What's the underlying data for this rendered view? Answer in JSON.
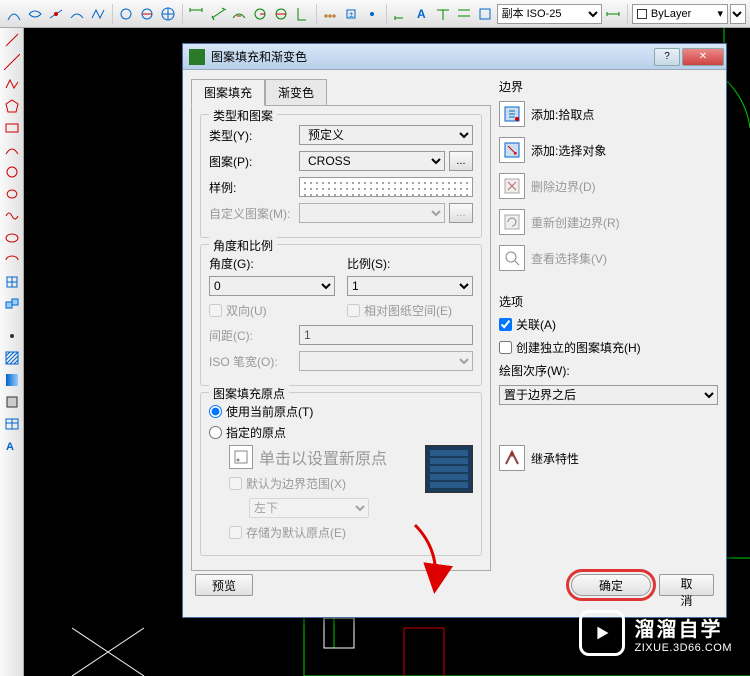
{
  "toolbar": {
    "dim_style": "副本 ISO-25",
    "layer": "ByLayer"
  },
  "dialog": {
    "title": "图案填充和渐变色",
    "tabs": {
      "hatch": "图案填充",
      "gradient": "渐变色"
    },
    "type_pattern": {
      "group": "类型和图案",
      "type_label": "类型(Y):",
      "type_value": "预定义",
      "pattern_label": "图案(P):",
      "pattern_value": "CROSS",
      "swatch_label": "样例:",
      "custom_label": "自定义图案(M):"
    },
    "angle_scale": {
      "group": "角度和比例",
      "angle_label": "角度(G):",
      "angle_value": "0",
      "scale_label": "比例(S):",
      "scale_value": "1",
      "double_label": "双向(U)",
      "paperspace_label": "相对图纸空间(E)",
      "spacing_label": "间距(C):",
      "spacing_value": "1",
      "isowidth_label": "ISO 笔宽(O):"
    },
    "origin": {
      "group": "图案填充原点",
      "use_current": "使用当前原点(T)",
      "specified": "指定的原点",
      "click_new": "单击以设置新原点",
      "default_extents": "默认为边界范围(X)",
      "position_value": "左下",
      "store": "存储为默认原点(E)"
    },
    "boundaries": {
      "group": "边界",
      "add_pick": "添加:拾取点",
      "add_select": "添加:选择对象",
      "remove": "删除边界(D)",
      "recreate": "重新创建边界(R)",
      "view_sel": "查看选择集(V)"
    },
    "options": {
      "group": "选项",
      "associative": "关联(A)",
      "separate": "创建独立的图案填充(H)",
      "draw_order_label": "绘图次序(W):",
      "draw_order_value": "置于边界之后"
    },
    "inherit": "继承特性",
    "footer": {
      "preview": "预览",
      "ok": "确定",
      "cancel": "取消"
    }
  },
  "watermark": {
    "title": "溜溜自学",
    "url": "ZIXUE.3D66.COM"
  }
}
